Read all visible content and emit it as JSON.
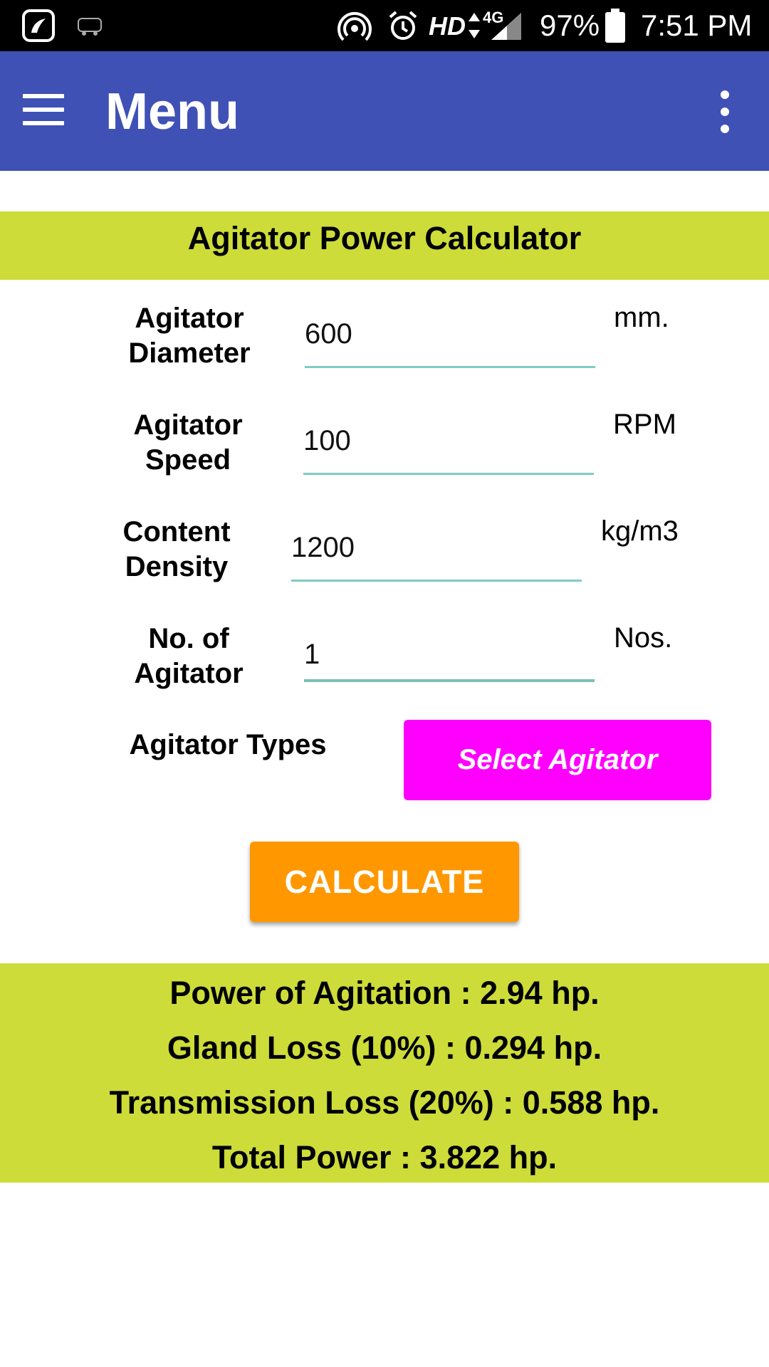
{
  "status_bar": {
    "battery": "97%",
    "time": "7:51 PM",
    "network_hd": "HD",
    "network_4g": "4G"
  },
  "app_bar": {
    "title": "Menu",
    "color": "#3F51B5"
  },
  "header": {
    "title": "Agitator Power Calculator",
    "color": "#CDDC39"
  },
  "form": {
    "diameter": {
      "label_1": "Agitator",
      "label_2": "Diameter",
      "value": "600",
      "unit": "mm."
    },
    "speed": {
      "label_1": "Agitator",
      "label_2": "Speed",
      "value": "100",
      "unit": "RPM"
    },
    "density": {
      "label_1": "Content",
      "label_2": "Density",
      "value": "1200",
      "unit": "kg/m3"
    },
    "count": {
      "label_1": "No. of",
      "label_2": "Agitator",
      "value": "1",
      "unit": "Nos."
    },
    "types": {
      "label": "Agitator Types",
      "button": "Select Agitator"
    }
  },
  "calculate_label": "CALCULATE",
  "results": {
    "power": "Power of Agitation : 2.94 hp.",
    "gland_loss": "Gland Loss (10%) : 0.294 hp.",
    "transmission_loss": "Transmission Loss (20%) : 0.588 hp.",
    "total": "Total Power : 3.822 hp."
  },
  "colors": {
    "select_button": "#FF00FF",
    "calculate_button": "#FF9800",
    "input_underline": "#80CBC4"
  }
}
